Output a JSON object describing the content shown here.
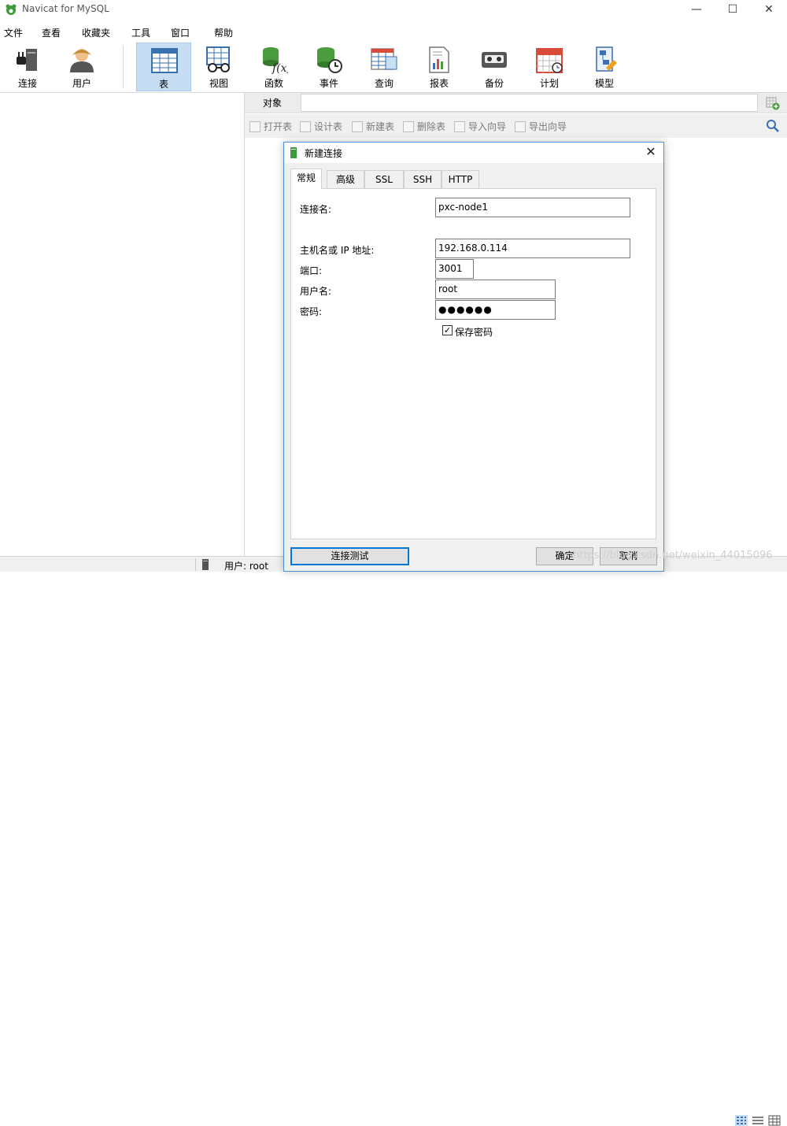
{
  "window": {
    "title": "Navicat for MySQL",
    "minimize": "—",
    "maximize": "☐",
    "close": "✕"
  },
  "menu": [
    "文件",
    "查看",
    "收藏夹",
    "工具",
    "窗口",
    "帮助"
  ],
  "toolbar": [
    {
      "label": "连接",
      "icon": "connection-icon"
    },
    {
      "label": "用户",
      "icon": "user-icon"
    },
    {
      "label": "表",
      "icon": "table-icon",
      "active": true
    },
    {
      "label": "视图",
      "icon": "view-icon"
    },
    {
      "label": "函数",
      "icon": "function-icon"
    },
    {
      "label": "事件",
      "icon": "event-icon"
    },
    {
      "label": "查询",
      "icon": "query-icon"
    },
    {
      "label": "报表",
      "icon": "report-icon"
    },
    {
      "label": "备份",
      "icon": "backup-icon"
    },
    {
      "label": "计划",
      "icon": "schedule-icon"
    },
    {
      "label": "模型",
      "icon": "model-icon"
    }
  ],
  "object_panel": {
    "tab": "对象",
    "actions": [
      "打开表",
      "设计表",
      "新建表",
      "删除表",
      "导入向导",
      "导出向导"
    ]
  },
  "statusbar": {
    "user": "用户: root"
  },
  "dialog": {
    "title": "新建连接",
    "tabs": [
      "常规",
      "高级",
      "SSL",
      "SSH",
      "HTTP"
    ],
    "fields": {
      "conn_name_label": "连接名:",
      "conn_name": "pxc-node1",
      "host_label": "主机名或 IP 地址:",
      "host": "192.168.0.114",
      "port_label": "端口:",
      "port": "3001",
      "user_label": "用户名:",
      "user": "root",
      "password_label": "密码:",
      "password": "●●●●●●",
      "save_password_label": "保存密码",
      "save_password": "✓"
    },
    "buttons": {
      "test": "连接测试",
      "ok": "确定",
      "cancel": "取消"
    }
  },
  "watermark": "https://blog.csdn.net/weixin_44015096"
}
